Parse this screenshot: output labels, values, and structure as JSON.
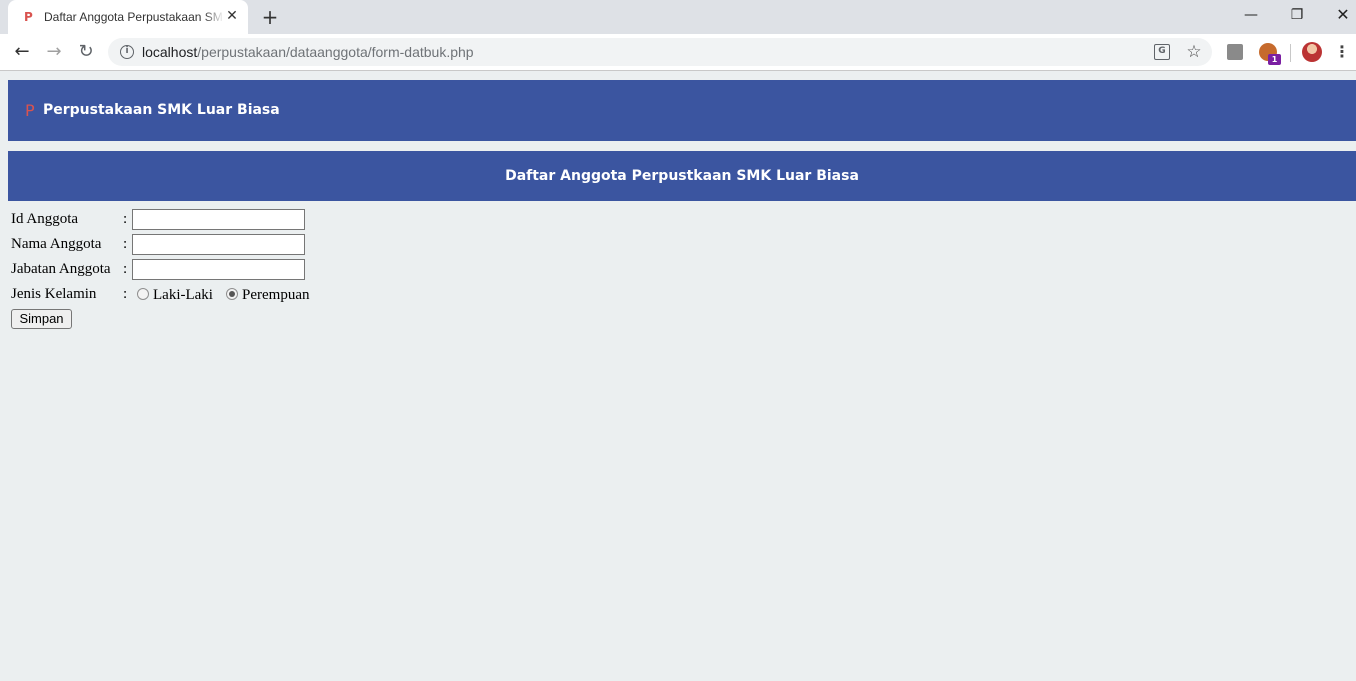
{
  "browser": {
    "tab": {
      "favicon": "P",
      "title": "Daftar Anggota Perpustakaan SMK Luar Biasa"
    },
    "new_tab": "+",
    "window": {
      "minimize": "—",
      "restore": "❐",
      "close": "✕"
    },
    "nav": {
      "back": "←",
      "forward": "→",
      "reload": "↻"
    },
    "url": {
      "host": "localhost",
      "path": "/perpustakaan/dataanggota/form-datbuk.php"
    },
    "extension_badge": "1"
  },
  "site": {
    "logo": "P",
    "title": "Perpustakaan SMK Luar Biasa",
    "brand_color": "#3b55a0"
  },
  "page": {
    "heading": "Daftar Anggota Perpustkaan SMK Luar Biasa"
  },
  "form": {
    "fields": [
      {
        "label": "Id Anggota",
        "colon": ":",
        "value": ""
      },
      {
        "label": "Nama Anggota",
        "colon": ":",
        "value": ""
      },
      {
        "label": "Jabatan Anggota",
        "colon": ":",
        "value": ""
      }
    ],
    "gender": {
      "label": "Jenis Kelamin",
      "colon": ":",
      "options": [
        {
          "label": "Laki-Laki",
          "checked": false
        },
        {
          "label": "Perempuan",
          "checked": true
        }
      ]
    },
    "submit_label": "Simpan"
  }
}
